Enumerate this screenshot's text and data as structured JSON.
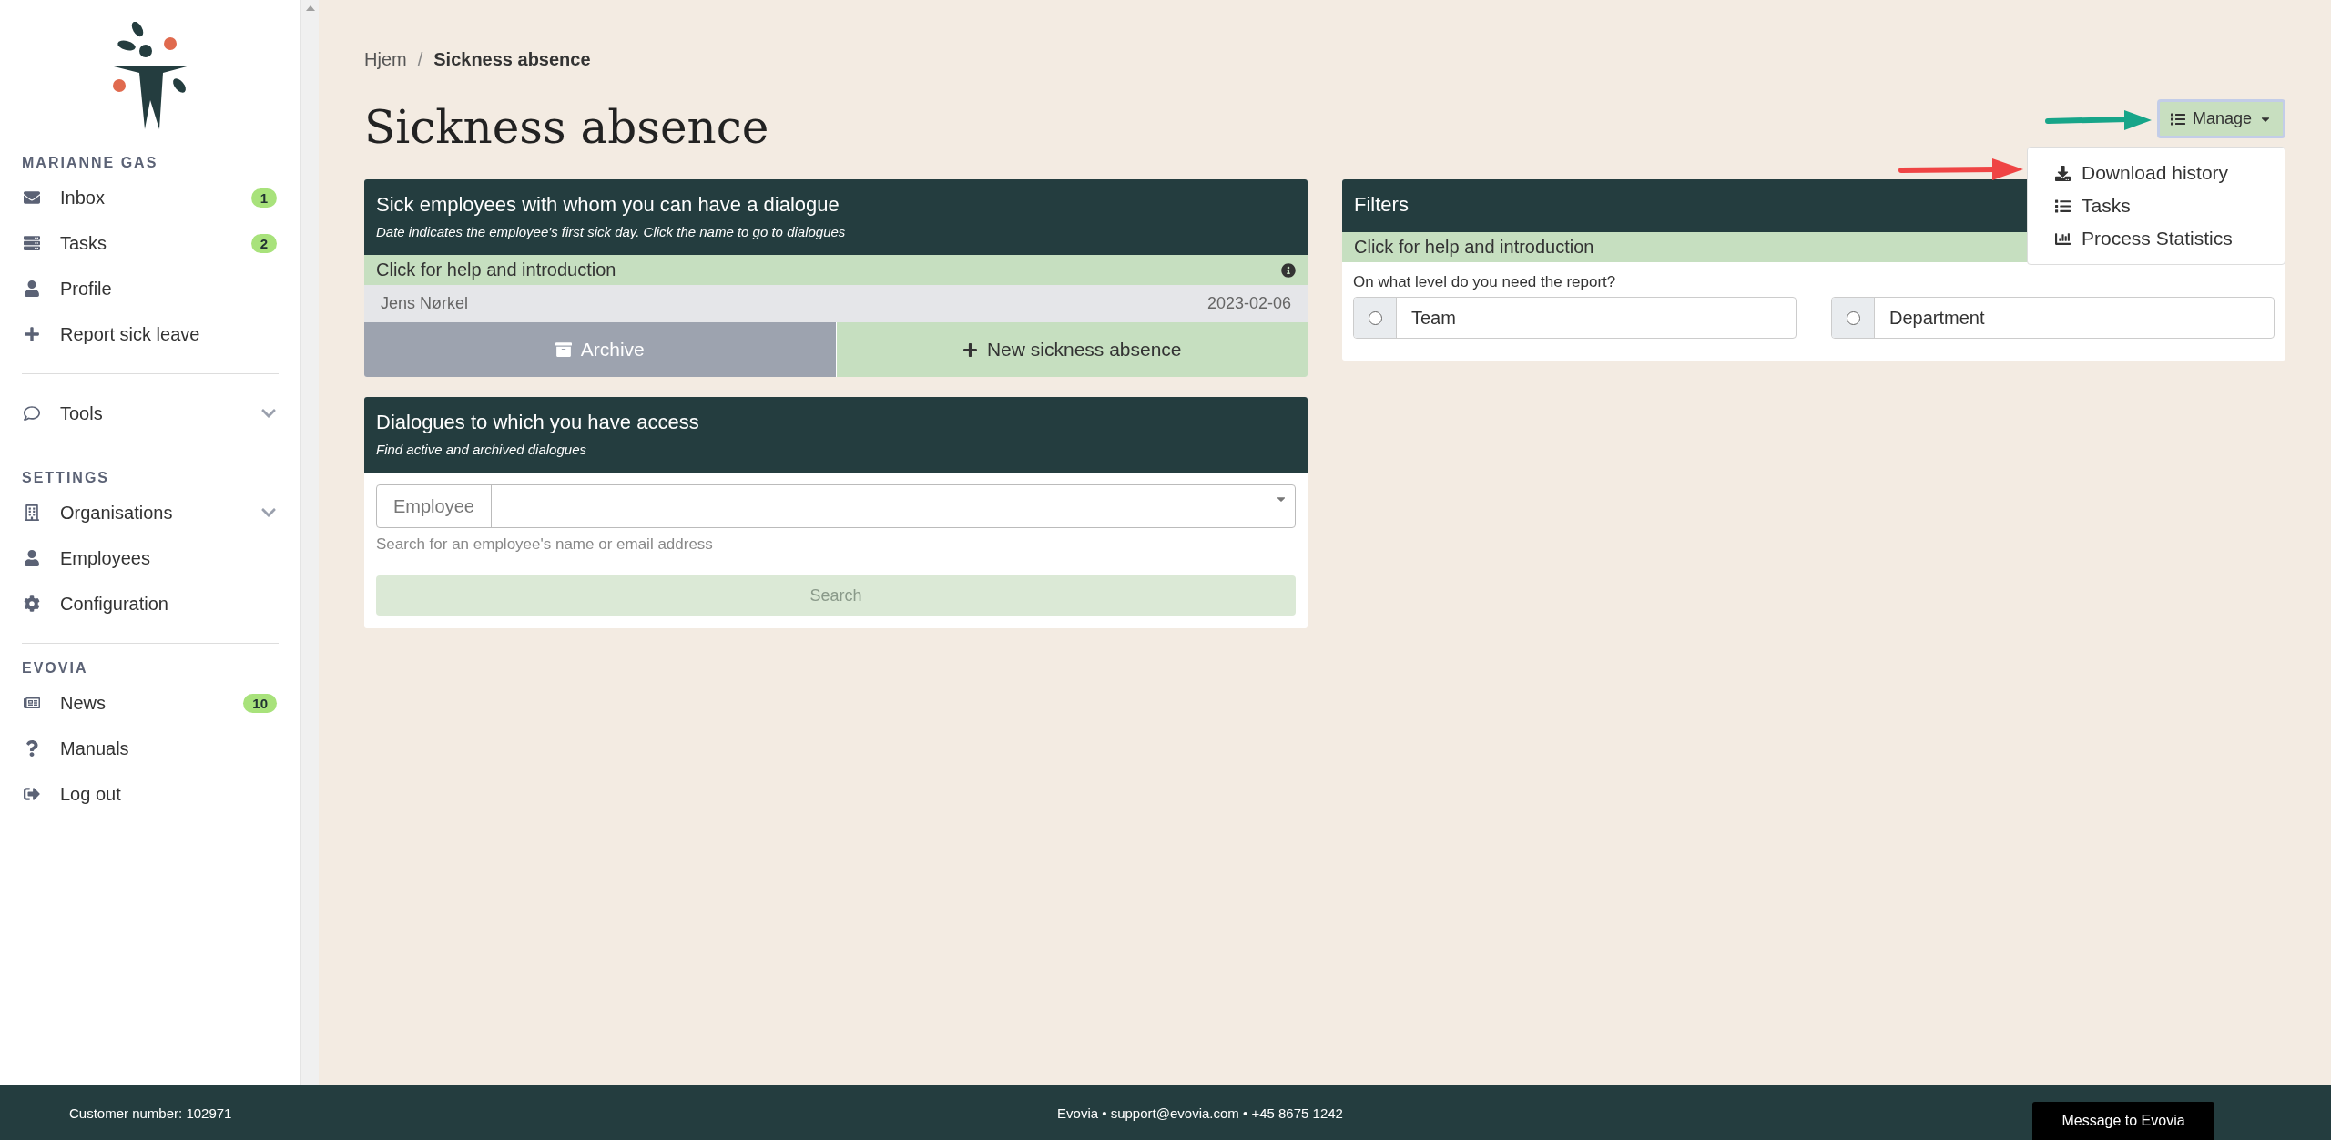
{
  "sidebar": {
    "sections": [
      {
        "heading": "MARIANNE GAS",
        "items": [
          {
            "label": "Inbox",
            "badge": "1"
          },
          {
            "label": "Tasks",
            "badge": "2"
          },
          {
            "label": "Profile"
          },
          {
            "label": "Report sick leave"
          }
        ]
      },
      {
        "items": [
          {
            "label": "Tools",
            "expanded": false
          }
        ]
      },
      {
        "heading": "SETTINGS",
        "items": [
          {
            "label": "Organisations",
            "expanded": false
          },
          {
            "label": "Employees"
          },
          {
            "label": "Configuration"
          }
        ]
      },
      {
        "heading": "EVOVIA",
        "items": [
          {
            "label": "News",
            "badge": "10"
          },
          {
            "label": "Manuals"
          },
          {
            "label": "Log out"
          }
        ]
      }
    ]
  },
  "breadcrumb": {
    "separator": "/",
    "items": [
      {
        "label": "Hjem",
        "current": false
      },
      {
        "label": "Sickness absence",
        "current": true
      }
    ]
  },
  "page_title": "Sickness absence",
  "manage_menu": {
    "label": "Manage",
    "expanded": true,
    "items": [
      "Download history",
      "Tasks",
      "Process Statistics"
    ]
  },
  "sick_panel": {
    "title": "Sick employees with whom you can have a dialogue",
    "subtitle": "Date indicates the employee's first sick day. Click the name to go to dialogues",
    "help": "Click for help and introduction",
    "employees": [
      {
        "name": "Jens Nørkel",
        "date": "2023-02-06"
      }
    ],
    "archive_button": "Archive",
    "new_button": "New sickness absence"
  },
  "dialogues_panel": {
    "title": "Dialogues to which you have access",
    "subtitle": "Find active and archived dialogues",
    "field_label": "Employee",
    "help_text": "Search for an employee's name or email address",
    "search_button": {
      "label": "Search",
      "disabled": true
    }
  },
  "filters_panel": {
    "title": "Filters",
    "help": "Click for help and introduction",
    "question": "On what level do you need the report?",
    "options": [
      {
        "label": "Team",
        "selected": false
      },
      {
        "label": "Department",
        "selected": false
      }
    ]
  },
  "footer": {
    "customer": "Customer number: 102971",
    "contact": "Evovia • support@evovia.com • +45 8675 1242",
    "message_button": "Message to Evovia"
  }
}
